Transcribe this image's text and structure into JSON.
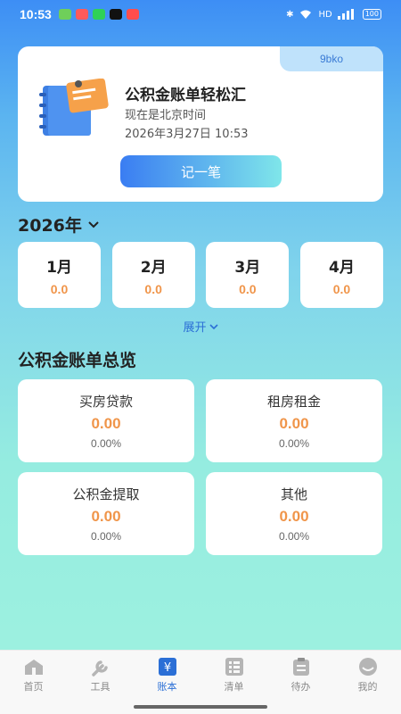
{
  "status_bar": {
    "time": "10:53",
    "battery": "100",
    "network": "HD"
  },
  "top_card": {
    "badge": "9bko",
    "title": "公积金账单轻松汇",
    "subtitle": "现在是北京时间",
    "datetime": "2026年3月27日 10:53",
    "record_button": "记一笔"
  },
  "year_selector": {
    "year": "2026年"
  },
  "months": [
    {
      "name": "1月",
      "value": "0.0"
    },
    {
      "name": "2月",
      "value": "0.0"
    },
    {
      "name": "3月",
      "value": "0.0"
    },
    {
      "name": "4月",
      "value": "0.0"
    }
  ],
  "expand_label": "展开",
  "overview": {
    "title": "公积金账单总览",
    "items": [
      {
        "label": "买房贷款",
        "amount": "0.00",
        "percent": "0.00%"
      },
      {
        "label": "租房租金",
        "amount": "0.00",
        "percent": "0.00%"
      },
      {
        "label": "公积金提取",
        "amount": "0.00",
        "percent": "0.00%"
      },
      {
        "label": "其他",
        "amount": "0.00",
        "percent": "0.00%"
      }
    ]
  },
  "bottom_nav": {
    "items": [
      {
        "label": "首页",
        "icon": "home-icon"
      },
      {
        "label": "工具",
        "icon": "wrench-icon"
      },
      {
        "label": "账本",
        "icon": "ledger-icon"
      },
      {
        "label": "清单",
        "icon": "list-icon"
      },
      {
        "label": "待办",
        "icon": "clipboard-icon"
      },
      {
        "label": "我的",
        "icon": "profile-icon"
      }
    ],
    "active_index": 2
  },
  "colors": {
    "accent": "#2b6fd6",
    "amount": "#f0954a"
  }
}
